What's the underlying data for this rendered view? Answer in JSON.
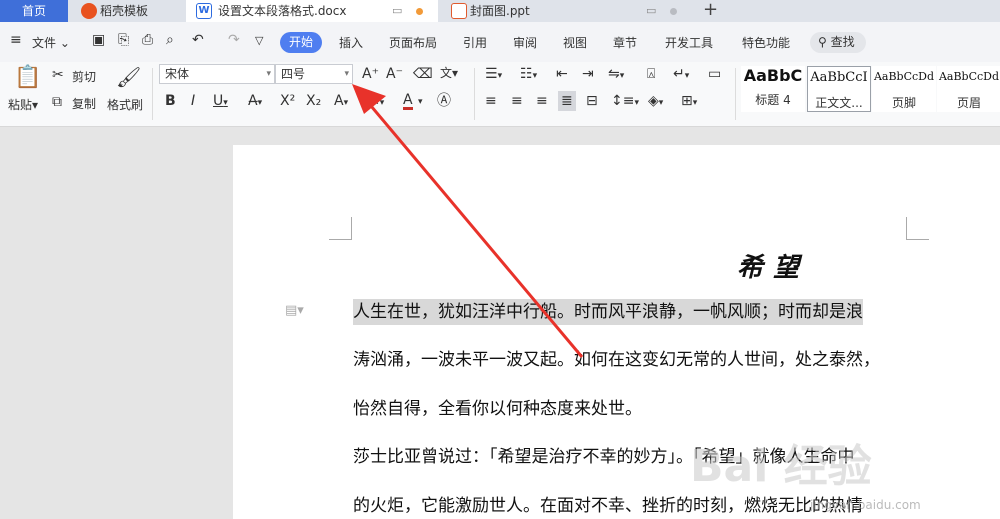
{
  "tabs": {
    "home": "首页",
    "daoke": "稻壳模板",
    "doc": "设置文本段落格式.docx",
    "ppt": "封面图.ppt",
    "doc_icon_letter": "W"
  },
  "menu": {
    "file": "文件",
    "items": [
      "开始",
      "插入",
      "页面布局",
      "引用",
      "审阅",
      "视图",
      "章节",
      "开发工具",
      "特色功能"
    ],
    "search": "查找"
  },
  "ribbon": {
    "paste": "粘贴",
    "cut": "剪切",
    "copy": "复制",
    "format_painter": "格式刷",
    "font_name": "宋体",
    "font_size": "四号",
    "bold": "B",
    "italic": "I",
    "underline": "U",
    "styles": [
      {
        "preview": "AaBbC",
        "name": "标题 4"
      },
      {
        "preview": "AaBbCcI",
        "name": "正文文..."
      },
      {
        "preview": "AaBbCcDd",
        "name": "页脚"
      },
      {
        "preview": "AaBbCcDd",
        "name": "页眉"
      }
    ]
  },
  "document": {
    "title": "希望",
    "lines": [
      "人生在世，犹如汪洋中行船。时而风平浪静，一帆风顺；时而却是浪",
      "涛汹涌，一波未平一波又起。如何在这变幻无常的人世间，处之泰然，",
      "怡然自得，全看你以何种态度来处世。",
      "莎士比亚曾说过：「希望是治疗不幸的妙方」。「希望」就像人生命中",
      "的火炬，它能激励世人。在面对不幸、挫折的时刻，燃烧无比的热情"
    ]
  },
  "watermark": {
    "text": "Bai 经验",
    "url": "jingyan.baidu.com"
  },
  "colors": {
    "accent": "#4f7ef0",
    "home_tab": "#3f6fd9",
    "arrow": "#e8322a",
    "highlight": "#d8d8d8"
  }
}
